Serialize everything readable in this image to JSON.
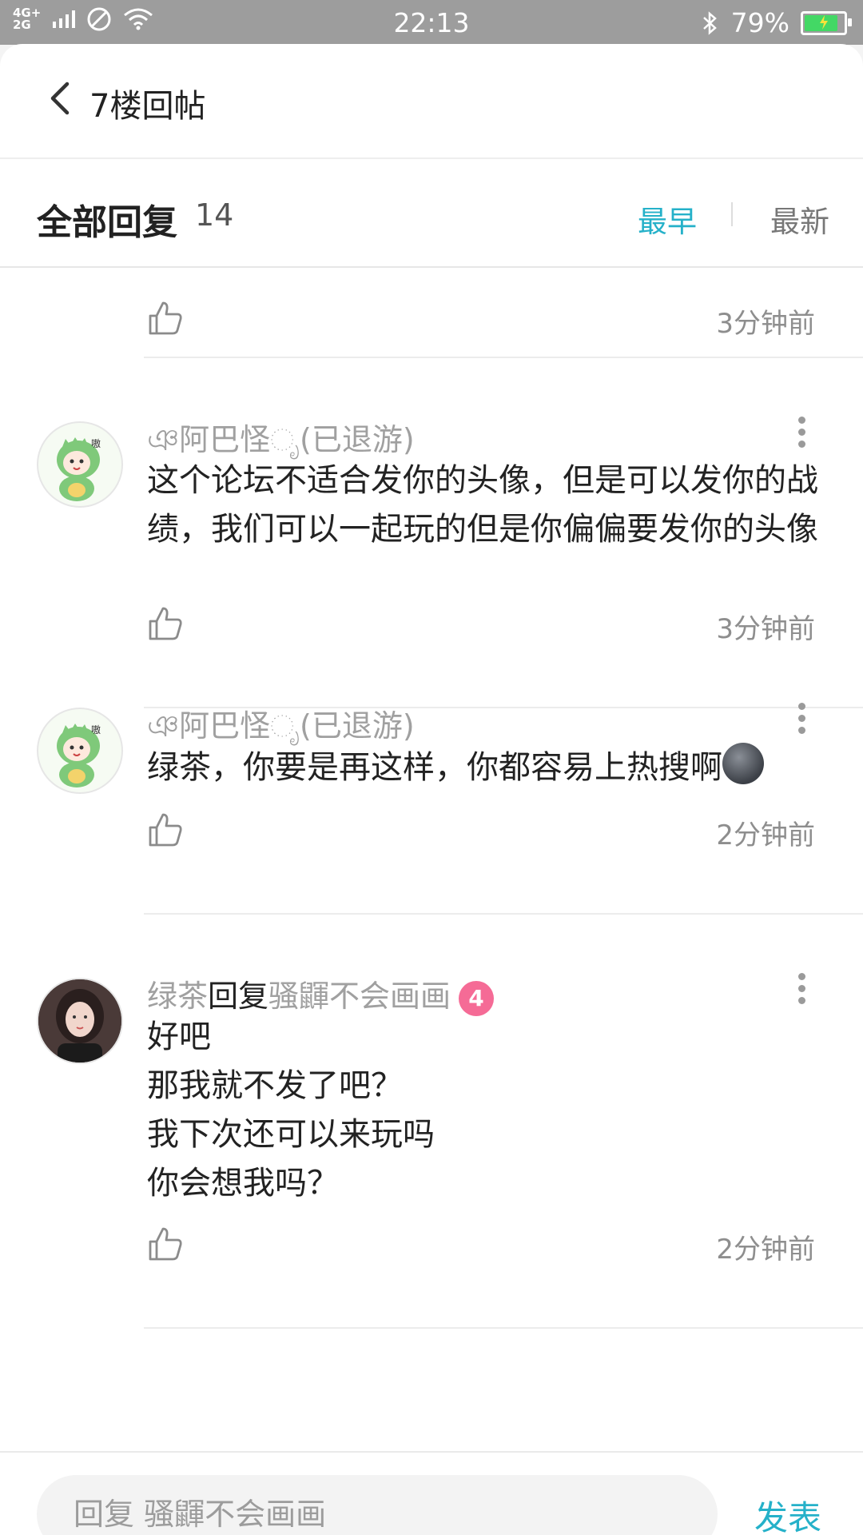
{
  "status": {
    "network": "4G+ 2G",
    "time": "22:13",
    "battery": "79%",
    "battery_level": 0.79
  },
  "header": {
    "title": "7楼回帖"
  },
  "sortbar": {
    "all_label": "全部回复",
    "count": "14",
    "sort_early": "最早",
    "sort_new": "最新"
  },
  "partial": {
    "time": "3分钟前"
  },
  "posts": [
    {
      "nickname": "ঞ阿巴怪ೃ(已退游)",
      "content": "这个论坛不适合发你的头像，但是可以发你的战绩，我们可以一起玩的但是你偏偏要发你的头像",
      "time": "3分钟前"
    },
    {
      "nickname": "ঞ阿巴怪ೃ(已退游)",
      "content": "绿茶，你要是再这样，你都容易上热搜啊",
      "time": "2分钟前"
    },
    {
      "author": "绿茶",
      "reply_word": "回复",
      "reply_to": "骚鼲不会画画",
      "level": "4",
      "lines": [
        "好吧",
        "那我就不发了吧？",
        "我下次还可以来玩吗",
        "你会想我吗？"
      ],
      "time": "2分钟前"
    }
  ],
  "bottom": {
    "placeholder": "回复 骚鼲不会画画",
    "send": "发表"
  }
}
